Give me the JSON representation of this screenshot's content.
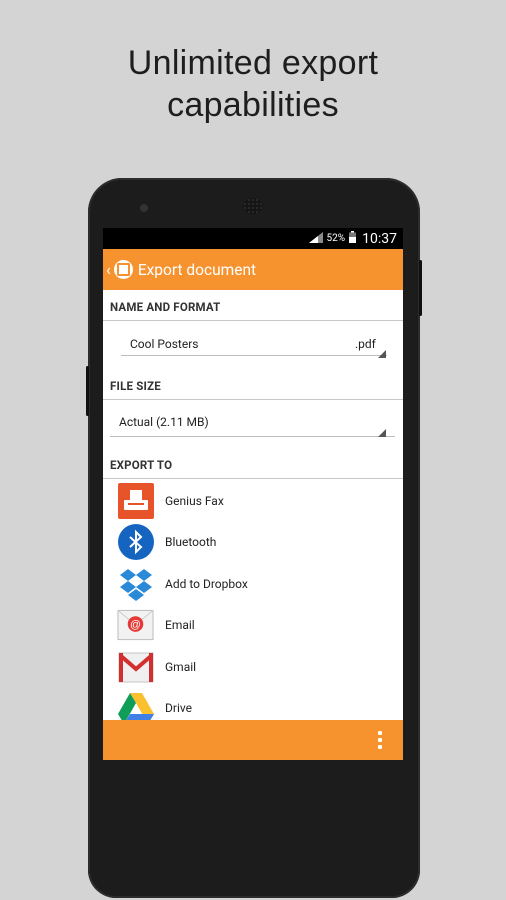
{
  "headline": {
    "line1": "Unlimited export",
    "line2": "capabilities"
  },
  "status_bar": {
    "battery_percent": "52%",
    "time": "10:37"
  },
  "app_bar": {
    "title": "Export document",
    "back_icon": "chevron-left-icon",
    "logo_icon": "genius-scan-logo-icon"
  },
  "name_and_format": {
    "header": "NAME AND FORMAT",
    "name_value": "Cool Posters",
    "format_value": ".pdf"
  },
  "file_size": {
    "header": "FILE SIZE",
    "selected": "Actual (2.11 MB)"
  },
  "export_to": {
    "header": "EXPORT TO",
    "items": [
      {
        "label": "Genius Fax",
        "icon": "genius-fax-icon"
      },
      {
        "label": "Bluetooth",
        "icon": "bluetooth-icon"
      },
      {
        "label": "Add to Dropbox",
        "icon": "dropbox-icon"
      },
      {
        "label": "Email",
        "icon": "email-icon"
      },
      {
        "label": "Gmail",
        "icon": "gmail-icon"
      },
      {
        "label": "Drive",
        "icon": "drive-icon"
      }
    ]
  },
  "colors": {
    "accent": "#f7932f",
    "background": "#d4d4d4",
    "bluetooth": "#1565c0",
    "dropbox": "#2b8ad8"
  }
}
